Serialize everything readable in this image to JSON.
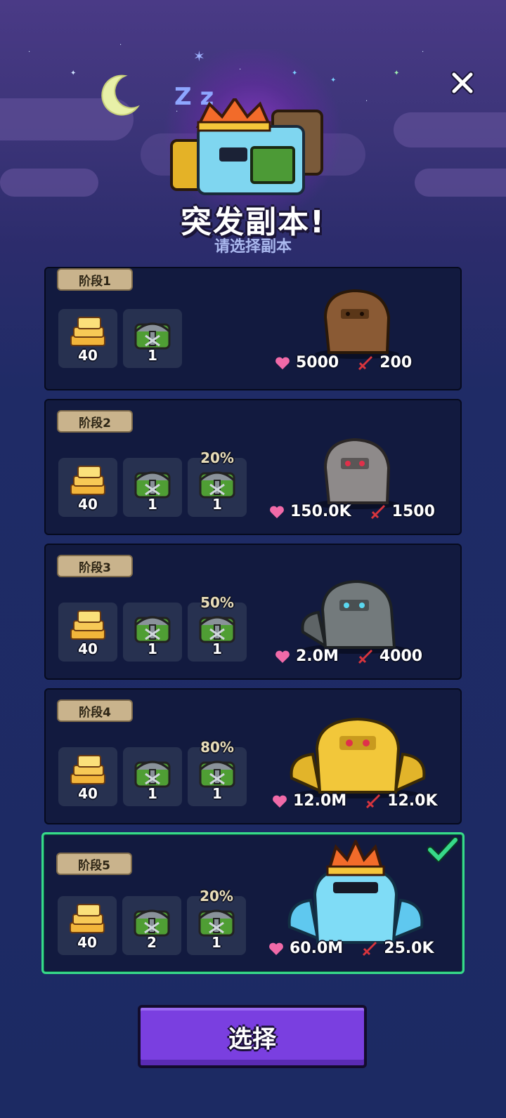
{
  "header": {
    "title": "突发副本!",
    "subtitle": "请选择副本",
    "close_icon": "close-icon",
    "sleep_text": "Z z"
  },
  "stages": [
    {
      "label": "阶段1",
      "gold": "40",
      "chest": "1",
      "bonus_pct": null,
      "bonus_chest": null,
      "hp": "5000",
      "atk": "200",
      "monster": "brown-golem",
      "selected": false
    },
    {
      "label": "阶段2",
      "gold": "40",
      "chest": "1",
      "bonus_pct": "20%",
      "bonus_chest": "1",
      "hp": "150.0K",
      "atk": "1500",
      "monster": "gray-golem",
      "selected": false
    },
    {
      "label": "阶段3",
      "gold": "40",
      "chest": "1",
      "bonus_pct": "50%",
      "bonus_chest": "1",
      "hp": "2.0M",
      "atk": "4000",
      "monster": "stone-golem",
      "selected": false
    },
    {
      "label": "阶段4",
      "gold": "40",
      "chest": "1",
      "bonus_pct": "80%",
      "bonus_chest": "1",
      "hp": "12.0M",
      "atk": "12.0K",
      "monster": "gold-golem",
      "selected": false
    },
    {
      "label": "阶段5",
      "gold": "40",
      "chest": "2",
      "bonus_pct": "20%",
      "bonus_chest": "1",
      "hp": "60.0M",
      "atk": "25.0K",
      "monster": "ice-golem-king",
      "selected": true
    }
  ],
  "select_button": {
    "label": "选择"
  },
  "colors": {
    "selected_border": "#37d98a",
    "button": "#7a3fe0",
    "heart": "#f06aa8",
    "sword": "#d8353d"
  }
}
